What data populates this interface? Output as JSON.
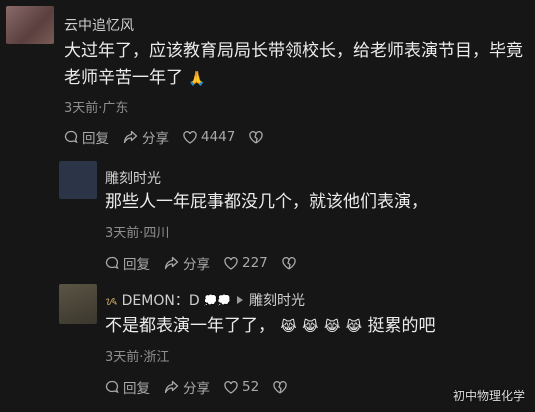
{
  "comments": [
    {
      "author": "云中追忆风",
      "text_line1": "大过年了，应该教育局局长带领校长，给老师表演节目，毕竟",
      "text_line2": "老师辛苦一年了",
      "text_emoji": "🙏",
      "meta": "3天前·广东",
      "reply_label": "回复",
      "share_label": "分享",
      "like_count": "4447",
      "avatar_color": "#6b4f4f"
    },
    {
      "author": "雕刻时光",
      "text": "那些人一年屁事都没几个，就该他们表演，",
      "meta": "3天前·四川",
      "reply_label": "回复",
      "share_label": "分享",
      "like_count": "227",
      "avatar_color": "#2b3547"
    },
    {
      "author": "DEMON：D",
      "reply_to": "雕刻时光",
      "text": "不是都表演一年了了，",
      "text_emojis": [
        "😹",
        "😹",
        "😹",
        "😹"
      ],
      "text_tail": "挺累的吧",
      "meta": "3天前·浙江",
      "reply_label": "回复",
      "share_label": "分享",
      "like_count": "52",
      "avatar_color": "#4a4538"
    }
  ],
  "watermark": "初中物理化学"
}
